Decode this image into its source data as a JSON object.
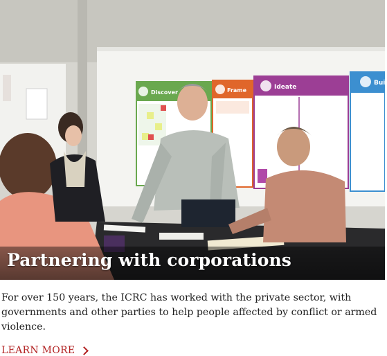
{
  "card": {
    "title": "Partnering with corporations",
    "description": "For over 150 years, the ICRC has worked with the private sector, with governments and other parties to help people affected by conflict or armed violence.",
    "link_label": "LEARN MORE",
    "link_icon": "chevron-right-icon"
  },
  "whiteboard": {
    "columns": [
      "Discover",
      "Frame",
      "Ideate",
      "Bui"
    ]
  },
  "colors": {
    "link": "#b22222",
    "text": "#222222",
    "title": "#ffffff",
    "discover": "#6aa84f",
    "frame": "#e0662a",
    "ideate": "#9c3e95",
    "build": "#3c8fd0"
  }
}
